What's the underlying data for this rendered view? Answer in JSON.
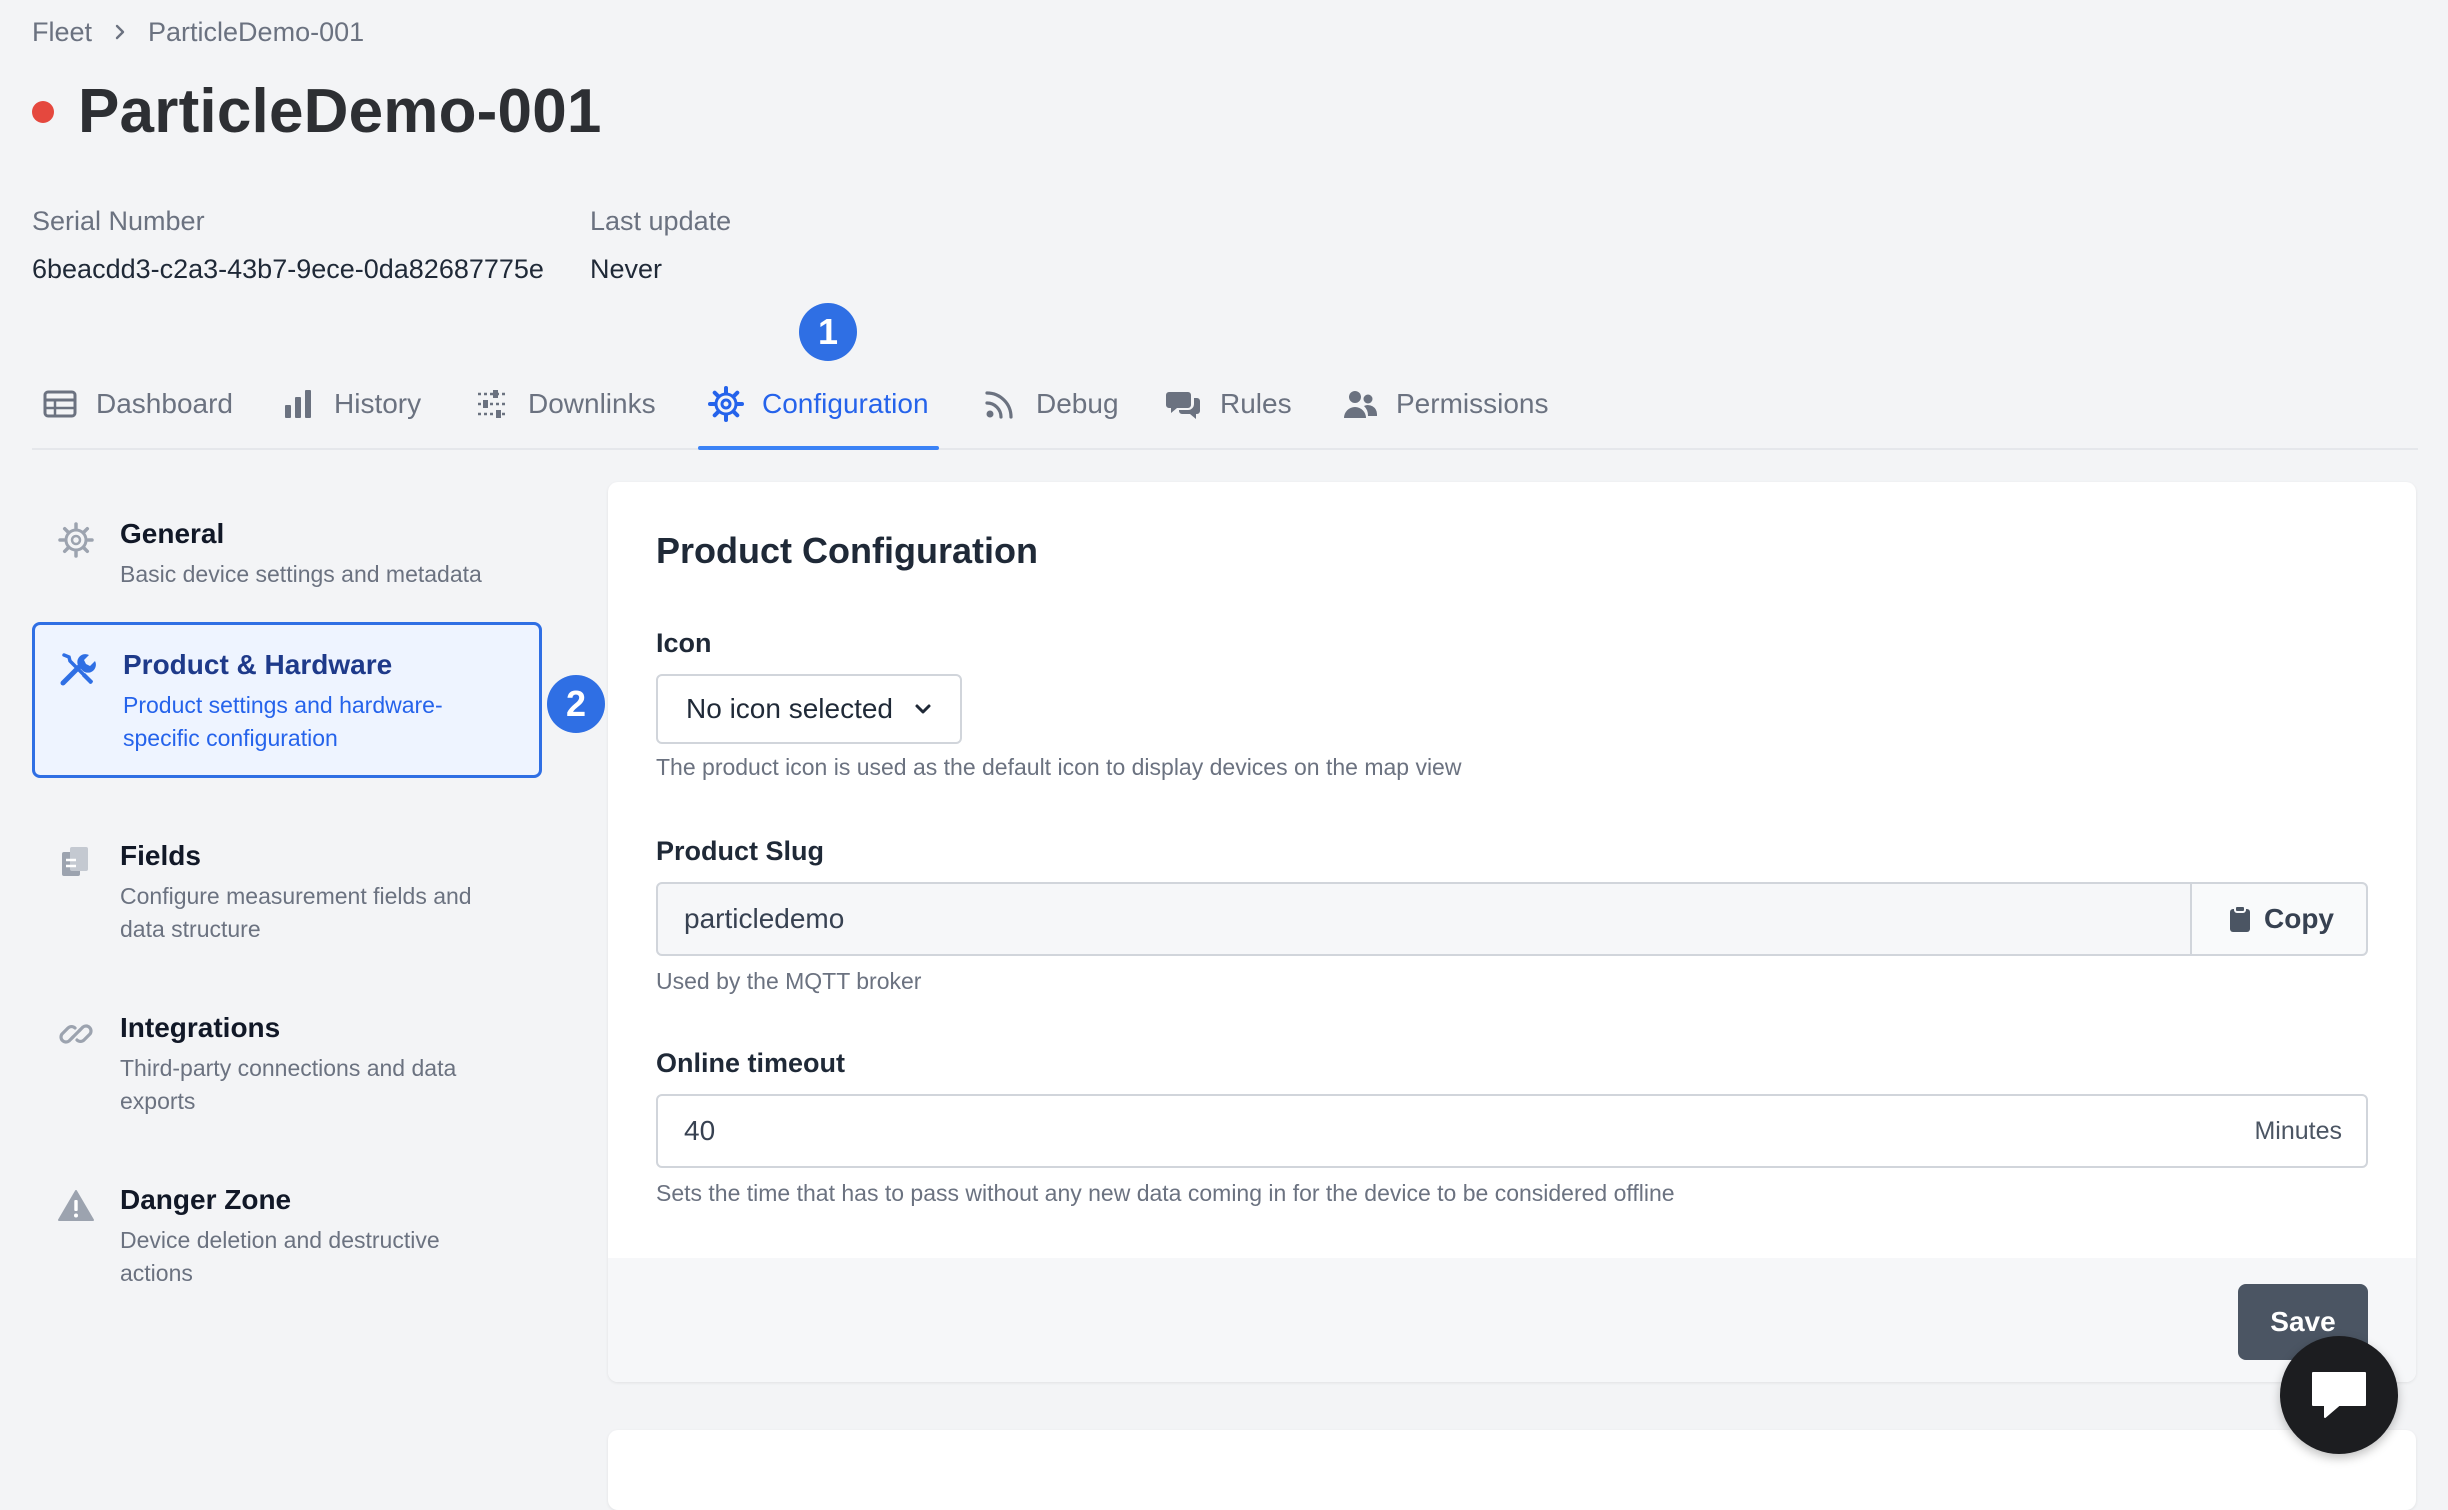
{
  "breadcrumb": {
    "root": "Fleet",
    "current": "ParticleDemo-001"
  },
  "device": {
    "name": "ParticleDemo-001",
    "status_color": "#e5483e",
    "serial_label": "Serial Number",
    "serial_value": "6beacdd3-c2a3-43b7-9ece-0da82687775e",
    "last_update_label": "Last update",
    "last_update_value": "Never"
  },
  "tabs": [
    {
      "label": "Dashboard",
      "icon": "table-icon"
    },
    {
      "label": "History",
      "icon": "bar-chart-icon"
    },
    {
      "label": "Downlinks",
      "icon": "sliders-icon"
    },
    {
      "label": "Configuration",
      "icon": "gear-icon",
      "active": true
    },
    {
      "label": "Debug",
      "icon": "rss-icon"
    },
    {
      "label": "Rules",
      "icon": "comments-icon"
    },
    {
      "label": "Permissions",
      "icon": "users-icon"
    }
  ],
  "step_badges": {
    "first": "1",
    "second": "2"
  },
  "sidebar": {
    "items": [
      {
        "title": "General",
        "desc": "Basic device settings and metadata",
        "icon": "gear-icon"
      },
      {
        "title": "Product & Hardware",
        "desc": "Product settings and hardware-specific configuration",
        "icon": "tools-icon",
        "active": true
      },
      {
        "title": "Fields",
        "desc": "Configure measurement fields and data structure",
        "icon": "clipboard-icon"
      },
      {
        "title": "Integrations",
        "desc": "Third-party connections and data exports",
        "icon": "link-icon"
      },
      {
        "title": "Danger Zone",
        "desc": "Device deletion and destructive actions",
        "icon": "warning-icon"
      }
    ]
  },
  "product_config": {
    "title": "Product Configuration",
    "icon_label": "Icon",
    "icon_select_value": "No icon selected",
    "icon_help": "The product icon is used as the default icon to display devices on the map view",
    "slug_label": "Product Slug",
    "slug_value": "particledemo",
    "copy_label": "Copy",
    "slug_help": "Used by the MQTT broker",
    "timeout_label": "Online timeout",
    "timeout_value": "40",
    "timeout_unit": "Minutes",
    "timeout_help": "Sets the time that has to pass without any new data coming in for the device to be considered offline",
    "save_label": "Save"
  },
  "colors": {
    "accent": "#2f6fe4",
    "active_tab": "#2563eb",
    "save_button": "#4b5563"
  }
}
